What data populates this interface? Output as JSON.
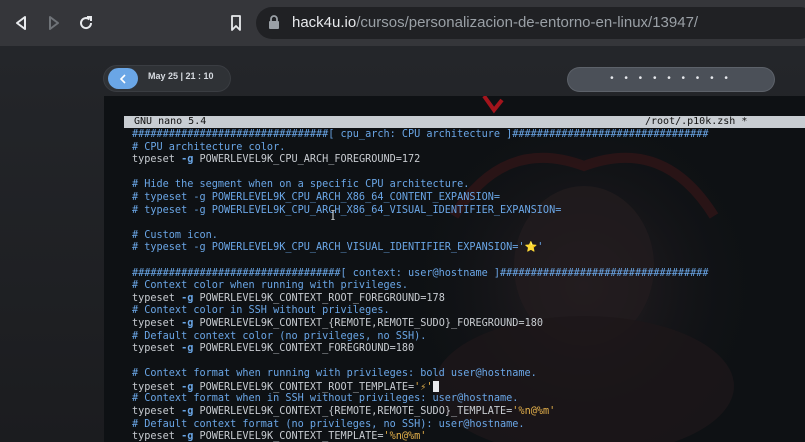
{
  "browser": {
    "url_host": "hack4u.io",
    "url_path": "/cursos/personalizacion-de-entorno-en-linux/13947/"
  },
  "desktop": {
    "datetime": "May 25 | 21 : 10",
    "workspace_dots": "• • • • • • • • •"
  },
  "nano": {
    "version": "GNU nano 5.4",
    "filename": "/root/.p10k.zsh *"
  },
  "lines": [
    {
      "type": "comment",
      "text": "################################[ cpu_arch: CPU architecture ]################################"
    },
    {
      "type": "comment",
      "text": "# CPU architecture color."
    },
    {
      "type": "typeset",
      "pre": "typeset ",
      "flag": "-g",
      "post": " POWERLEVEL9K_CPU_ARCH_FOREGROUND=172"
    },
    {
      "type": "blank",
      "text": ""
    },
    {
      "type": "comment",
      "text": "# Hide the segment when on a specific CPU architecture."
    },
    {
      "type": "comment",
      "text": "# typeset -g POWERLEVEL9K_CPU_ARCH_X86_64_CONTENT_EXPANSION="
    },
    {
      "type": "comment",
      "text": "# typeset -g POWERLEVEL9K_CPU_ARCH_X86_64_VISUAL_IDENTIFIER_EXPANSION="
    },
    {
      "type": "blank",
      "text": ""
    },
    {
      "type": "comment",
      "text": "# Custom icon."
    },
    {
      "type": "comment",
      "text": "# typeset -g POWERLEVEL9K_CPU_ARCH_VISUAL_IDENTIFIER_EXPANSION='⭐'"
    },
    {
      "type": "blank",
      "text": ""
    },
    {
      "type": "comment",
      "text": "##################################[ context: user@hostname ]##################################"
    },
    {
      "type": "comment",
      "text": "# Context color when running with privileges."
    },
    {
      "type": "typeset",
      "pre": "typeset ",
      "flag": "-g",
      "post": " POWERLEVEL9K_CONTEXT_ROOT_FOREGROUND=178"
    },
    {
      "type": "comment",
      "text": "# Context color in SSH without privileges."
    },
    {
      "type": "typeset",
      "pre": "typeset ",
      "flag": "-g",
      "post": " POWERLEVEL9K_CONTEXT_{REMOTE,REMOTE_SUDO}_FOREGROUND=180"
    },
    {
      "type": "comment",
      "text": "# Default context color (no privileges, no SSH)."
    },
    {
      "type": "typeset",
      "pre": "typeset ",
      "flag": "-g",
      "post": " POWERLEVEL9K_CONTEXT_FOREGROUND=180"
    },
    {
      "type": "blank",
      "text": ""
    },
    {
      "type": "comment",
      "text": "# Context format when running with privileges: bold user@hostname."
    },
    {
      "type": "typeset",
      "pre": "typeset ",
      "flag": "-g",
      "post": " POWERLEVEL9K_CONTEXT_ROOT_TEMPLATE=",
      "str": "'⚡'",
      "cursor": true
    },
    {
      "type": "comment",
      "text": "# Context format when in SSH without privileges: user@hostname."
    },
    {
      "type": "typeset",
      "pre": "typeset ",
      "flag": "-g",
      "post": " POWERLEVEL9K_CONTEXT_{REMOTE,REMOTE_SUDO}_TEMPLATE=",
      "str": "'%n@%m'"
    },
    {
      "type": "comment",
      "text": "# Default context format (no privileges, no SSH): user@hostname."
    },
    {
      "type": "typeset",
      "pre": "typeset ",
      "flag": "-g",
      "post": " POWERLEVEL9K_CONTEXT_TEMPLATE=",
      "str": "'%n@%m'"
    }
  ]
}
